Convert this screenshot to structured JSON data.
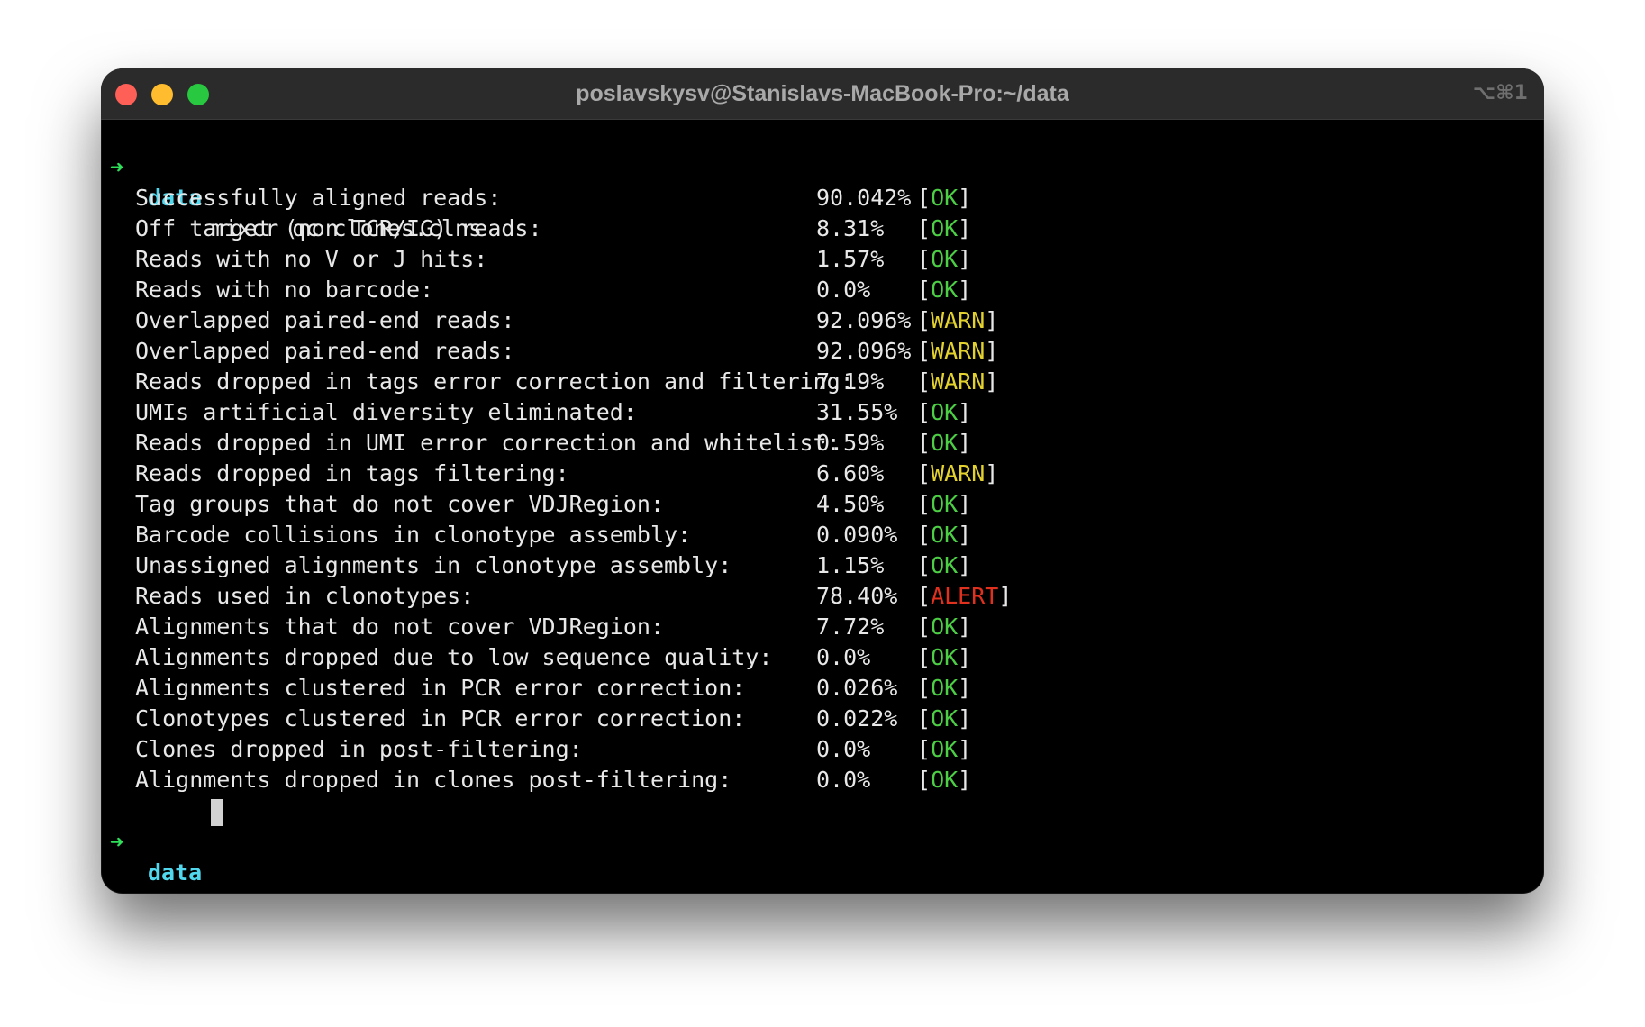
{
  "window": {
    "title": "poslavskysv@Stanislavs-MacBook-Pro:~/data",
    "shortcut": "⌥⌘1"
  },
  "prompt": {
    "arrow": "➜",
    "dir": "data",
    "command": "mixcr qc clones.clns"
  },
  "qc_rows": [
    {
      "label": "Successfully aligned reads:",
      "value": "90.042%",
      "status": "OK"
    },
    {
      "label": "Off target (non TCR/IG) reads:",
      "value": "8.31%",
      "status": "OK"
    },
    {
      "label": "Reads with no V or J hits:",
      "value": "1.57%",
      "status": "OK"
    },
    {
      "label": "Reads with no barcode:",
      "value": "0.0%",
      "status": "OK"
    },
    {
      "label": "Overlapped paired-end reads:",
      "value": "92.096%",
      "status": "WARN"
    },
    {
      "label": "Overlapped paired-end reads:",
      "value": "92.096%",
      "status": "WARN"
    },
    {
      "label": "Reads dropped in tags error correction and filtering:",
      "value": "7.19%",
      "status": "WARN"
    },
    {
      "label": "UMIs artificial diversity eliminated:",
      "value": "31.55%",
      "status": "OK"
    },
    {
      "label": "Reads dropped in UMI error correction and whitelist:",
      "value": "0.59%",
      "status": "OK"
    },
    {
      "label": "Reads dropped in tags filtering:",
      "value": "6.60%",
      "status": "WARN"
    },
    {
      "label": "Tag groups that do not cover VDJRegion:",
      "value": "4.50%",
      "status": "OK"
    },
    {
      "label": "Barcode collisions in clonotype assembly:",
      "value": "0.090%",
      "status": "OK"
    },
    {
      "label": "Unassigned alignments in clonotype assembly:",
      "value": "1.15%",
      "status": "OK"
    },
    {
      "label": "Reads used in clonotypes:",
      "value": "78.40%",
      "status": "ALERT"
    },
    {
      "label": "Alignments that do not cover VDJRegion:",
      "value": "7.72%",
      "status": "OK"
    },
    {
      "label": "Alignments dropped due to low sequence quality:",
      "value": "0.0%",
      "status": "OK"
    },
    {
      "label": "Alignments clustered in PCR error correction:",
      "value": "0.026%",
      "status": "OK"
    },
    {
      "label": "Clonotypes clustered in PCR error correction:",
      "value": "0.022%",
      "status": "OK"
    },
    {
      "label": "Clones dropped in post-filtering:",
      "value": "0.0%",
      "status": "OK"
    },
    {
      "label": "Alignments dropped in clones post-filtering:",
      "value": "0.0%",
      "status": "OK"
    }
  ],
  "status_colors": {
    "OK": "#4ccf45",
    "WARN": "#e2d12f",
    "ALERT": "#e0301e"
  },
  "icons": {
    "close": "close-icon",
    "minimize": "minimize-icon",
    "maximize": "maximize-icon"
  }
}
